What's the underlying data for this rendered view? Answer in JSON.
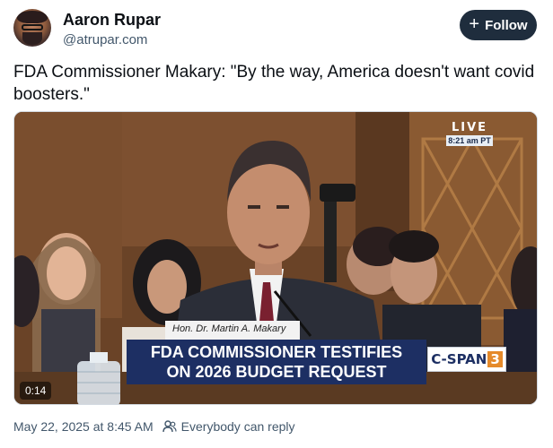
{
  "author": {
    "display_name": "Aaron Rupar",
    "handle": "@atrupar.com"
  },
  "follow_button": {
    "icon": "plus-icon",
    "label": "Follow"
  },
  "post": {
    "text": "FDA Commissioner Makary: \"By the way, America doesn't want covid boosters.\"",
    "timestamp": "May 22, 2025 at 8:45 AM",
    "reply_setting_icon": "people-icon",
    "reply_setting": "Everybody can reply"
  },
  "video": {
    "live_label": "LIVE",
    "live_time": "8:21 am PT",
    "nameplate": "Hon. Dr. Martin A. Makary",
    "chyron_line1": "FDA COMMISSIONER TESTIFIES",
    "chyron_line2": "ON 2026 BUDGET REQUEST",
    "network_logo_text": "C-SPAN",
    "network_logo_number": "3",
    "timecode": "0:14"
  },
  "colors": {
    "follow_bg": "#1f2d3d",
    "secondary_text": "#42576b",
    "chyron_bg": "#1d2f63",
    "cspan_accent": "#e58a2a"
  }
}
